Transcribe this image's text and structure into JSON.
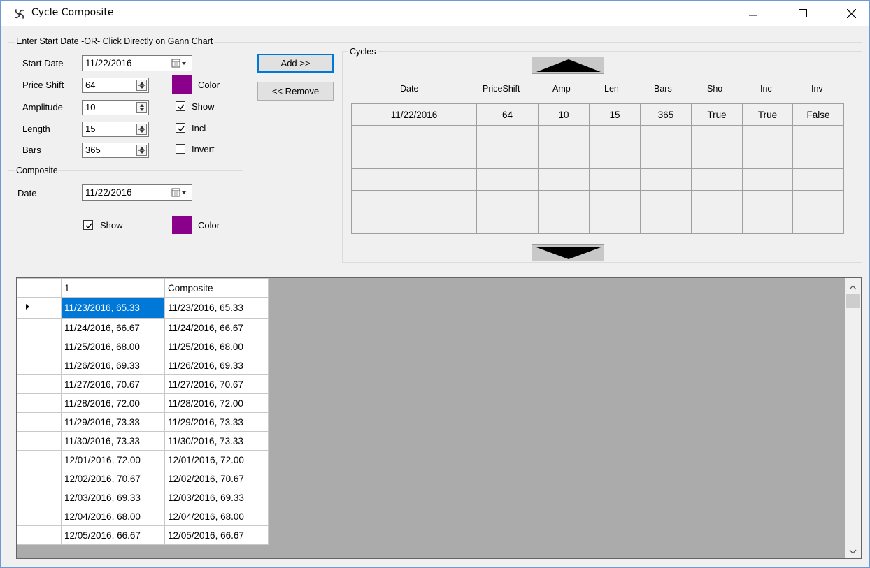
{
  "window": {
    "title": "Cycle Composite",
    "app_icon": "spiral-icon"
  },
  "colors": {
    "swatch": "#8b008b",
    "selection": "#0078d7",
    "grid_background": "#ababab"
  },
  "input_group": {
    "legend": "Enter Start Date -OR- Click Directly on Gann Chart",
    "start_date_label": "Start Date",
    "start_date_value": "11/22/2016",
    "price_shift_label": "Price Shift",
    "price_shift_value": "64",
    "amplitude_label": "Amplitude",
    "amplitude_value": "10",
    "length_label": "Length",
    "length_value": "15",
    "bars_label": "Bars",
    "bars_value": "365",
    "color_label": "Color",
    "show_label": "Show",
    "show_checked": true,
    "incl_label": "Incl",
    "incl_checked": true,
    "invert_label": "Invert",
    "invert_checked": false
  },
  "composite_group": {
    "legend": "Composite",
    "date_label": "Date",
    "date_value": "11/22/2016",
    "show_label": "Show",
    "show_checked": true,
    "color_label": "Color"
  },
  "buttons": {
    "add": "Add >>",
    "remove": "<< Remove"
  },
  "cycles_group": {
    "legend": "Cycles",
    "columns": [
      "Date",
      "PriceShift",
      "Amp",
      "Len",
      "Bars",
      "Sho",
      "Inc",
      "Inv"
    ],
    "rows": [
      [
        "11/22/2016",
        "64",
        "10",
        "15",
        "365",
        "True",
        "True",
        "False"
      ],
      [
        "",
        "",
        "",
        "",
        "",
        "",
        "",
        ""
      ],
      [
        "",
        "",
        "",
        "",
        "",
        "",
        "",
        ""
      ],
      [
        "",
        "",
        "",
        "",
        "",
        "",
        "",
        ""
      ],
      [
        "",
        "",
        "",
        "",
        "",
        "",
        "",
        ""
      ],
      [
        "",
        "",
        "",
        "",
        "",
        "",
        "",
        ""
      ]
    ]
  },
  "data_grid": {
    "columns": [
      "1",
      "Composite"
    ],
    "rows": [
      [
        "11/23/2016, 65.33",
        "11/23/2016, 65.33"
      ],
      [
        "11/24/2016, 66.67",
        "11/24/2016, 66.67"
      ],
      [
        "11/25/2016, 68.00",
        "11/25/2016, 68.00"
      ],
      [
        "11/26/2016, 69.33",
        "11/26/2016, 69.33"
      ],
      [
        "11/27/2016, 70.67",
        "11/27/2016, 70.67"
      ],
      [
        "11/28/2016, 72.00",
        "11/28/2016, 72.00"
      ],
      [
        "11/29/2016, 73.33",
        "11/29/2016, 73.33"
      ],
      [
        "11/30/2016, 73.33",
        "11/30/2016, 73.33"
      ],
      [
        "12/01/2016, 72.00",
        "12/01/2016, 72.00"
      ],
      [
        "12/02/2016, 70.67",
        "12/02/2016, 70.67"
      ],
      [
        "12/03/2016, 69.33",
        "12/03/2016, 69.33"
      ],
      [
        "12/04/2016, 68.00",
        "12/04/2016, 68.00"
      ],
      [
        "12/05/2016, 66.67",
        "12/05/2016, 66.67"
      ]
    ]
  }
}
